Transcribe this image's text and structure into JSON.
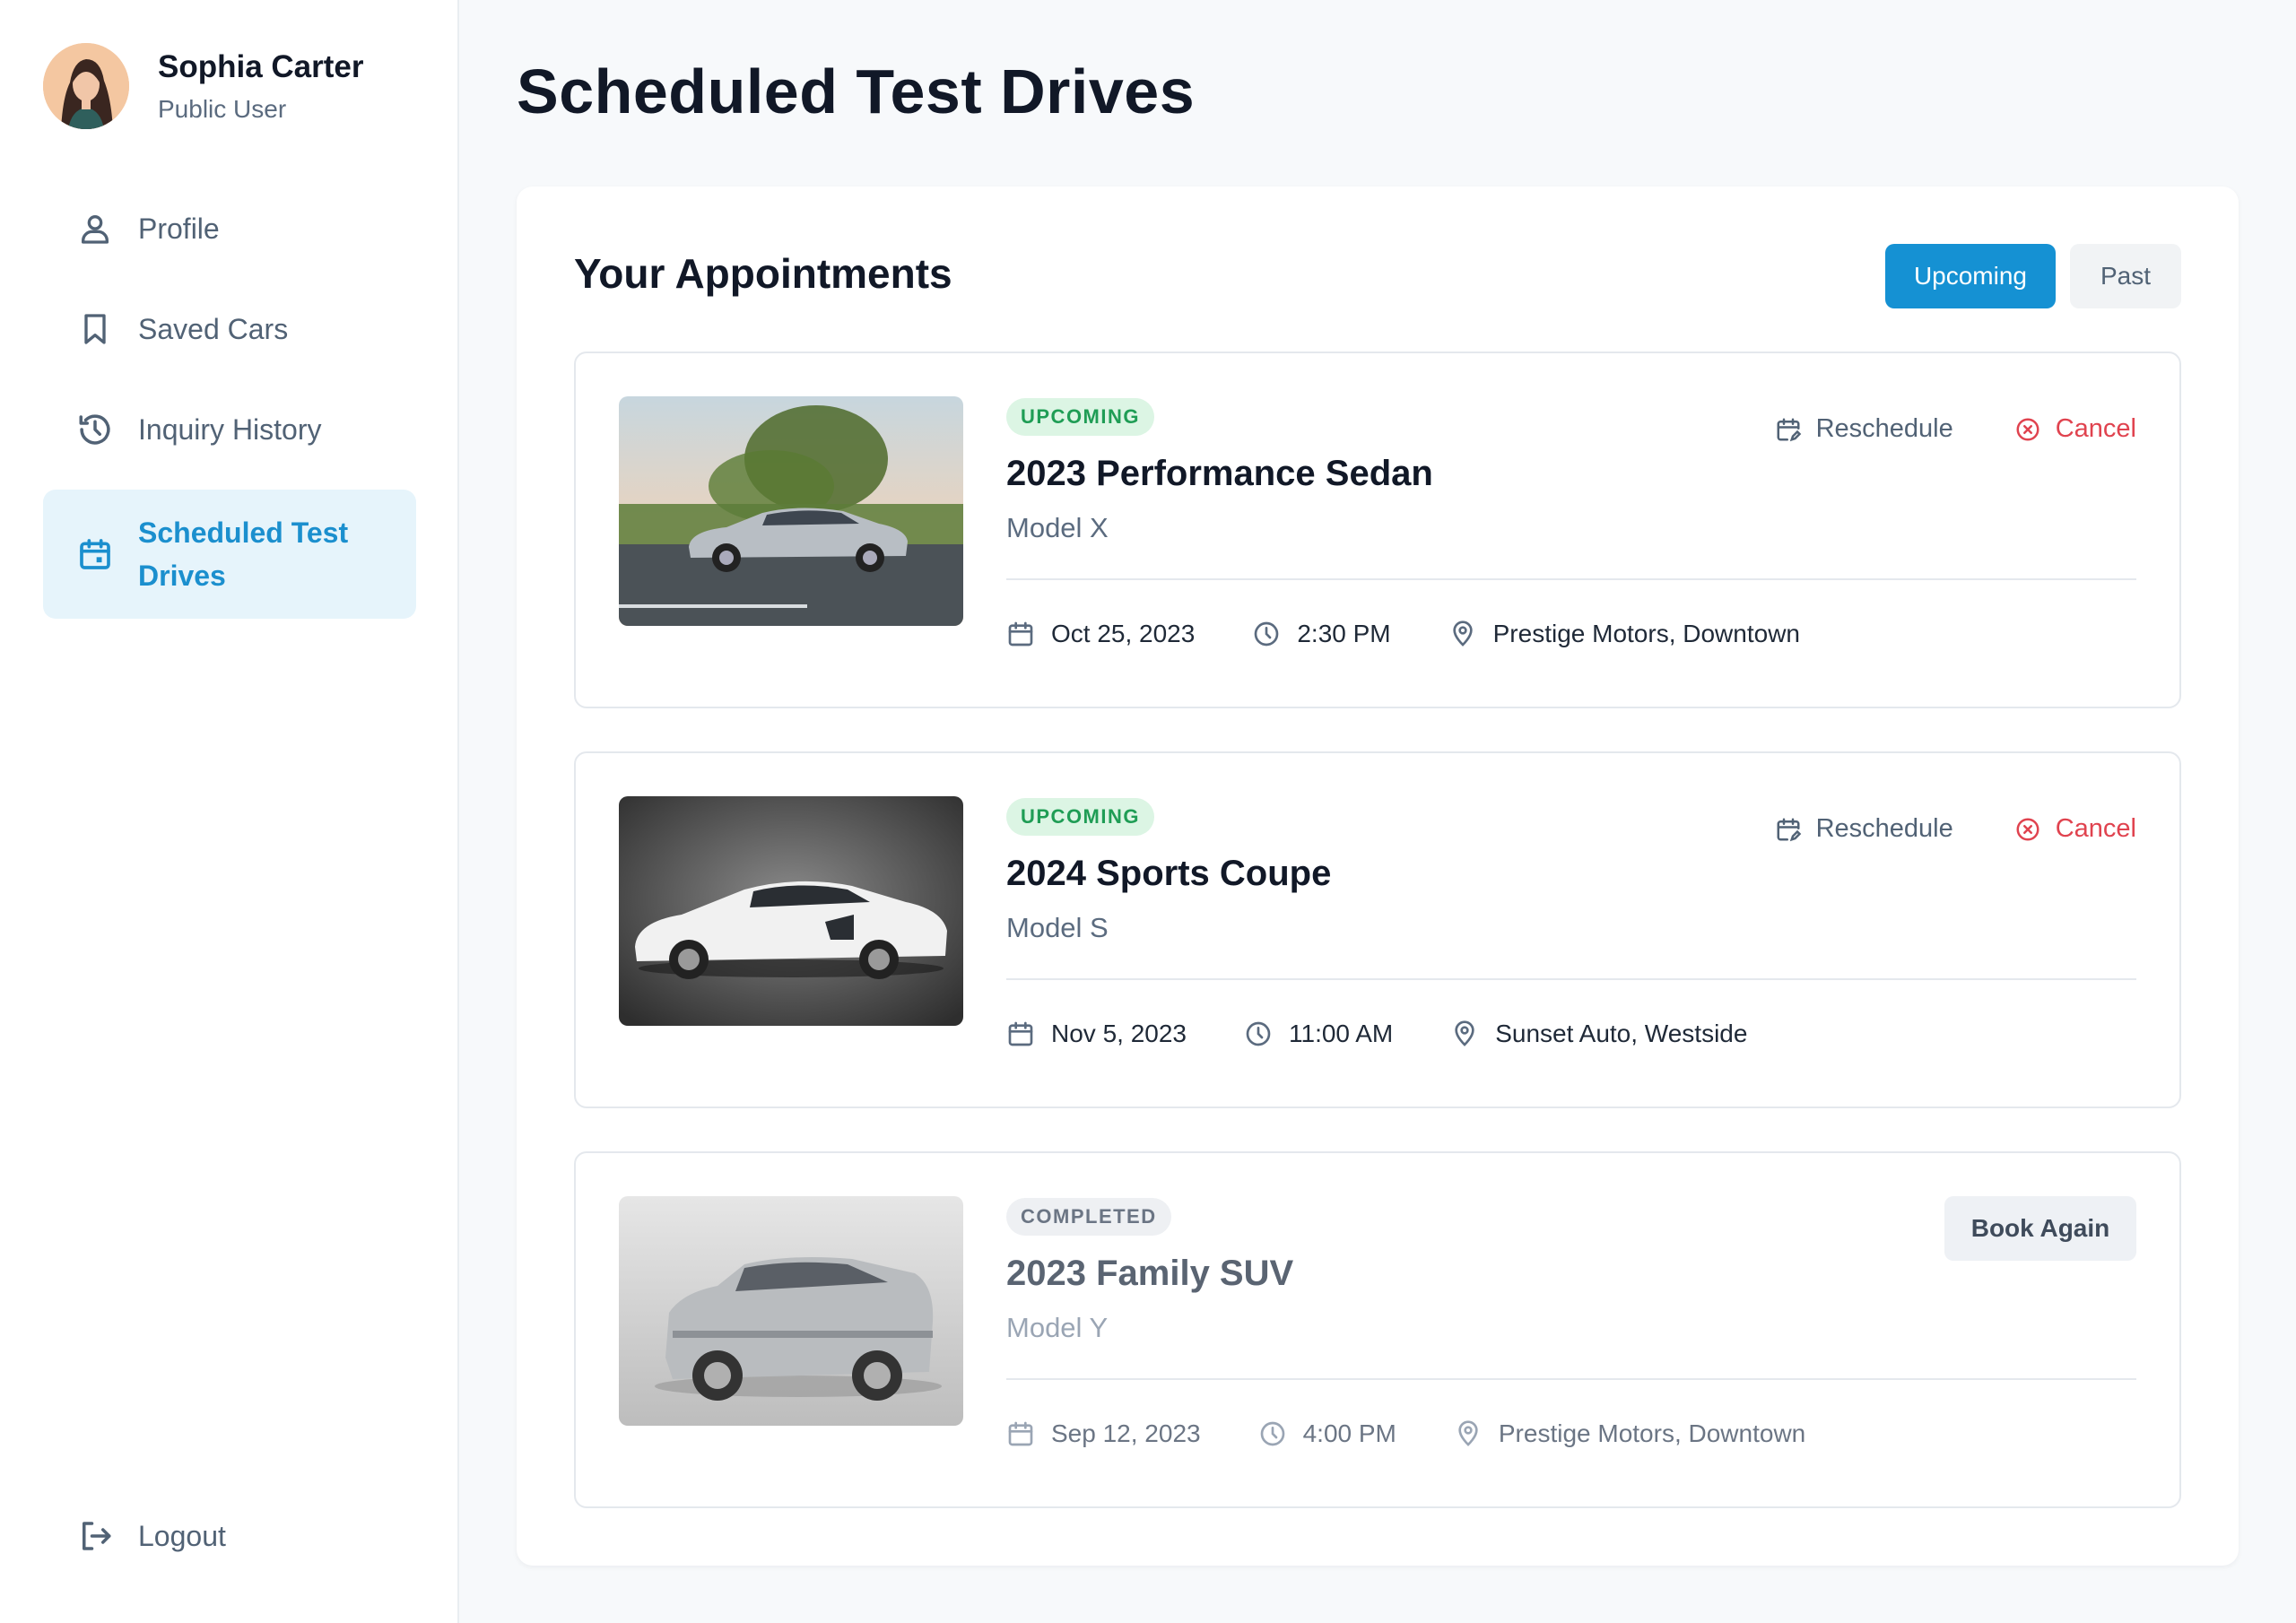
{
  "user": {
    "name": "Sophia Carter",
    "role": "Public User"
  },
  "sidebar": {
    "items": [
      {
        "label": "Profile",
        "icon": "user-icon"
      },
      {
        "label": "Saved Cars",
        "icon": "bookmark-icon"
      },
      {
        "label": "Inquiry History",
        "icon": "history-icon"
      },
      {
        "label": "Scheduled Test Drives",
        "icon": "calendar-icon",
        "active": true
      }
    ],
    "logout_label": "Logout"
  },
  "page": {
    "title": "Scheduled Test Drives"
  },
  "panel": {
    "title": "Your Appointments",
    "tabs": {
      "upcoming": "Upcoming",
      "past": "Past"
    }
  },
  "appointments": [
    {
      "status": "UPCOMING",
      "title": "2023 Performance Sedan",
      "model": "Model X",
      "date": "Oct 25, 2023",
      "time": "2:30 PM",
      "location": "Prestige Motors, Downtown",
      "reschedule_label": "Reschedule",
      "cancel_label": "Cancel"
    },
    {
      "status": "UPCOMING",
      "title": "2024 Sports Coupe",
      "model": "Model S",
      "date": "Nov 5, 2023",
      "time": "11:00 AM",
      "location": "Sunset Auto, Westside",
      "reschedule_label": "Reschedule",
      "cancel_label": "Cancel"
    },
    {
      "status": "COMPLETED",
      "title": "2023 Family SUV",
      "model": "Model Y",
      "date": "Sep 12, 2023",
      "time": "4:00 PM",
      "location": "Prestige Motors, Downtown",
      "book_again_label": "Book Again"
    }
  ],
  "colors": {
    "accent": "#1591d3",
    "upcoming_badge": "#1f9d55",
    "cancel": "#e0434f"
  }
}
